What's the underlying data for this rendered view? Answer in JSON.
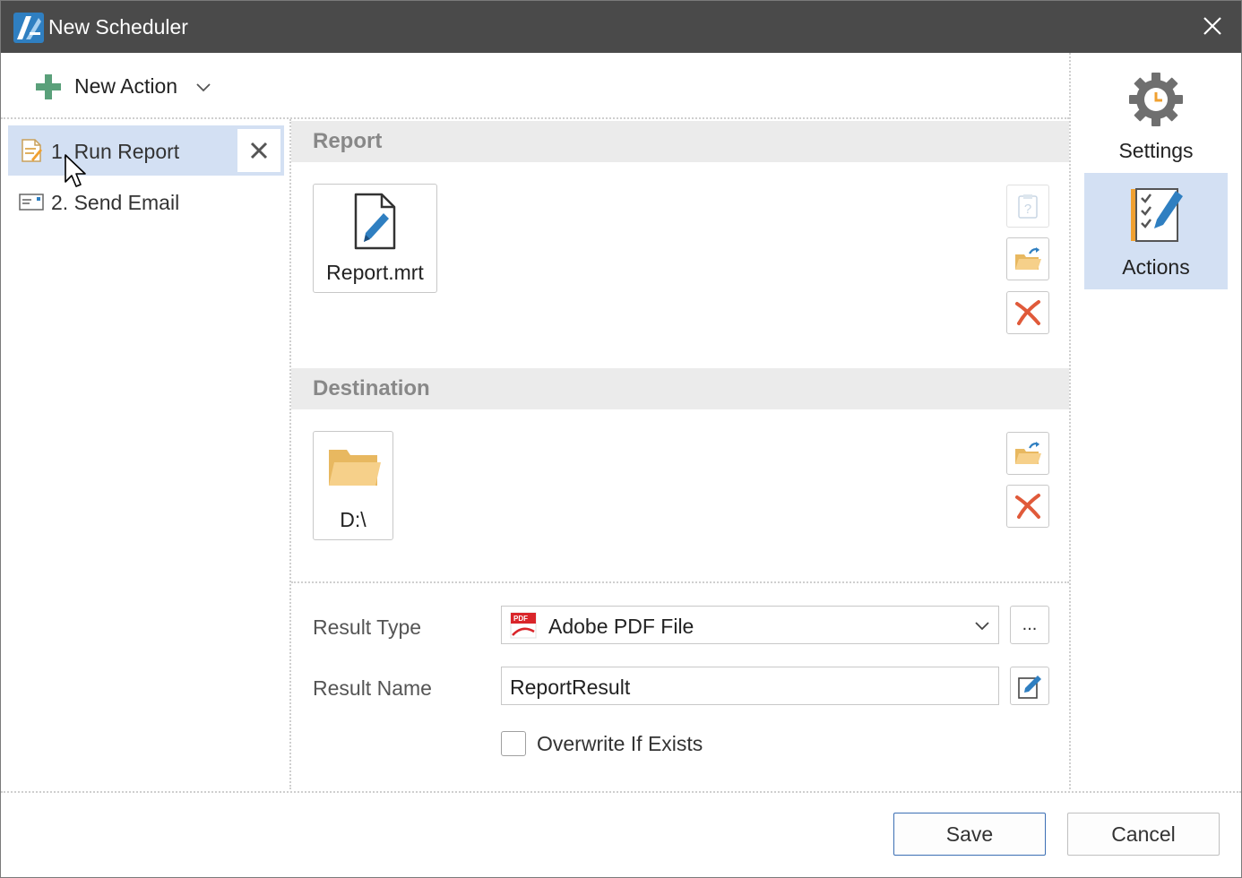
{
  "window": {
    "title": "New Scheduler"
  },
  "toolbar": {
    "new_action_label": "New Action"
  },
  "actions": [
    {
      "label": "1. Run Report",
      "selected": true,
      "icon": "report-icon"
    },
    {
      "label": "2. Send Email",
      "selected": false,
      "icon": "email-icon"
    }
  ],
  "report_section": {
    "header": "Report",
    "file_name": "Report.mrt"
  },
  "destination_section": {
    "header": "Destination",
    "path": "D:\\"
  },
  "result": {
    "type_label": "Result Type",
    "type_value": "Adobe PDF File",
    "type_icon_text": "PDF",
    "more_button": "...",
    "name_label": "Result Name",
    "name_value": "ReportResult",
    "overwrite_label": "Overwrite If Exists",
    "overwrite_checked": false
  },
  "right_tabs": [
    {
      "label": "Settings",
      "selected": false,
      "icon": "gear-clock-icon"
    },
    {
      "label": "Actions",
      "selected": true,
      "icon": "checklist-pencil-icon"
    }
  ],
  "footer": {
    "save_label": "Save",
    "cancel_label": "Cancel"
  },
  "colors": {
    "titlebar": "#4a4a4a",
    "selection": "#d3e0f3",
    "accent_blue": "#2f7fc1",
    "plus_green": "#5aa07a",
    "remove_red": "#e05a3a",
    "folder_yellow": "#f3c778"
  }
}
